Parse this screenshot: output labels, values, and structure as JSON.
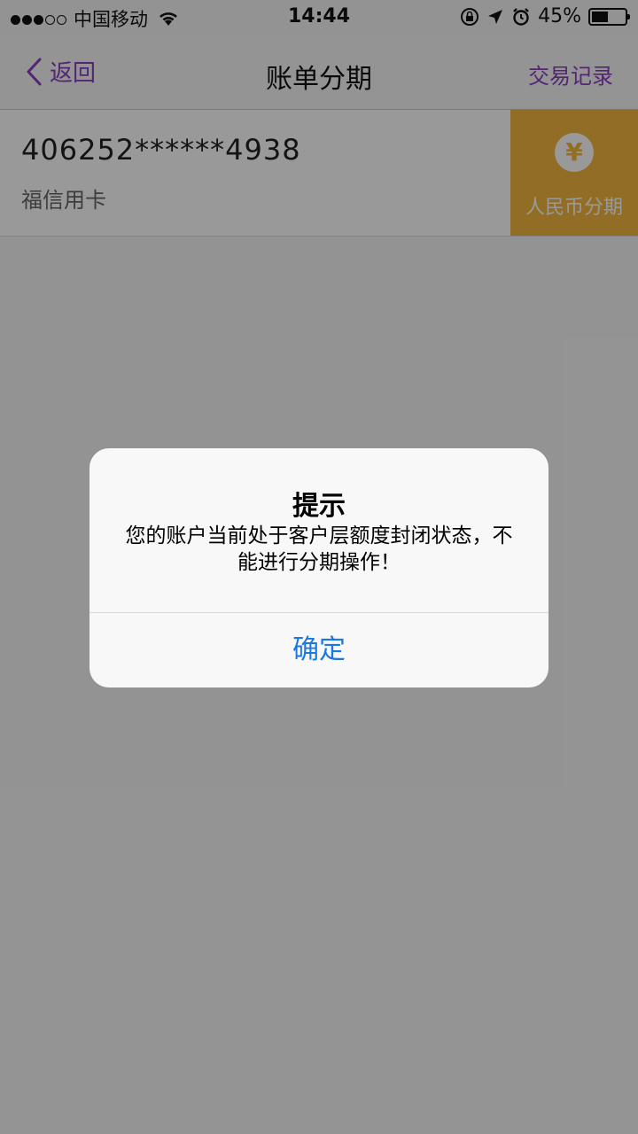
{
  "status_bar": {
    "carrier": "中国移动",
    "time": "14:44",
    "battery": "45%",
    "battery_level": 0.45,
    "signal_bars": 3,
    "signal_total": 5
  },
  "nav": {
    "back_label": "返回",
    "title": "账单分期",
    "right_label": "交易记录",
    "accent_color": "#8a3fc0"
  },
  "card": {
    "number": "406252******4938",
    "type": "福信用卡",
    "action_label": "人民币分期",
    "action_icon": "yen-icon",
    "action_symbol": "¥",
    "action_color": "#f3b63f"
  },
  "alert": {
    "title": "提示",
    "message": "您的账户当前处于客户层额度封闭状态，不能进行分期操作！",
    "confirm_label": "确定",
    "button_color": "#1a78e0"
  }
}
